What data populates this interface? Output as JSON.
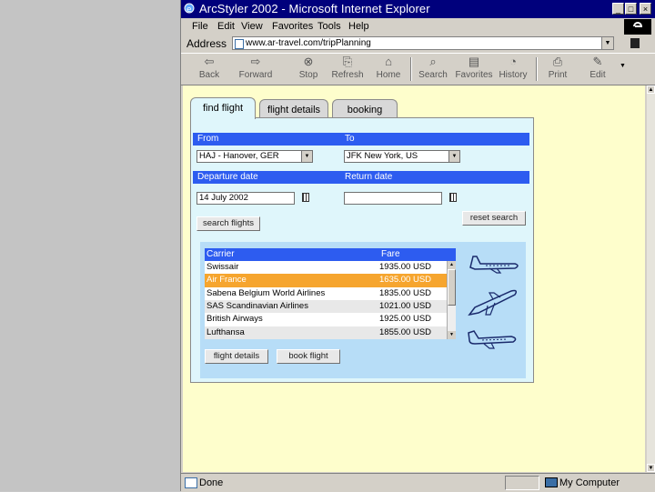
{
  "window": {
    "title": "ArcStyler 2002 - Microsoft Internet Explorer",
    "minimize": "_",
    "maximize": "□",
    "close": "×"
  },
  "menu": [
    "File",
    "Edit",
    "View",
    "Favorites",
    "Tools",
    "Help"
  ],
  "address": {
    "label": "Address",
    "url": "www.ar-travel.com/tripPlanning"
  },
  "toolbar": {
    "back": "Back",
    "forward": "Forward",
    "stop": "Stop",
    "refresh": "Refresh",
    "home": "Home",
    "search": "Search",
    "favorites": "Favorites",
    "history": "History",
    "print": "Print",
    "edit": "Edit"
  },
  "tabs": [
    {
      "label": "find flight",
      "active": true
    },
    {
      "label": "flight details",
      "active": false
    },
    {
      "label": "booking",
      "active": false
    }
  ],
  "form": {
    "from_label": "From",
    "to_label": "To",
    "from_value": "HAJ - Hanover, GER",
    "to_value": "JFK New York, US",
    "departure_label": "Departure date",
    "return_label": "Return date",
    "departure_value": "14 July 2002",
    "return_value": "",
    "search_button": "search flights",
    "reset_button": "reset search"
  },
  "results": {
    "columns": [
      "Carrier",
      "Fare"
    ],
    "rows": [
      {
        "carrier": "Swissair",
        "fare": "1935.00 USD",
        "selected": false
      },
      {
        "carrier": "Air France",
        "fare": "1635.00 USD",
        "selected": true
      },
      {
        "carrier": "Sabena Belgium World Airlines",
        "fare": "1835.00 USD",
        "selected": false
      },
      {
        "carrier": "SAS Scandinavian Airlines",
        "fare": "1021.00 USD",
        "selected": false
      },
      {
        "carrier": "British Airways",
        "fare": "1925.00 USD",
        "selected": false
      },
      {
        "carrier": "Lufthansa",
        "fare": "1855.00 USD",
        "selected": false
      }
    ],
    "details_button": "flight details",
    "book_button": "book flight"
  },
  "status": {
    "text": "Done",
    "zone": "My Computer"
  },
  "colors": {
    "titlebar": "#00007c",
    "header_blue": "#2d5cf0",
    "panel": "#dff6fb",
    "page_bg": "#fefecc",
    "selected_row": "#f6a52e"
  }
}
